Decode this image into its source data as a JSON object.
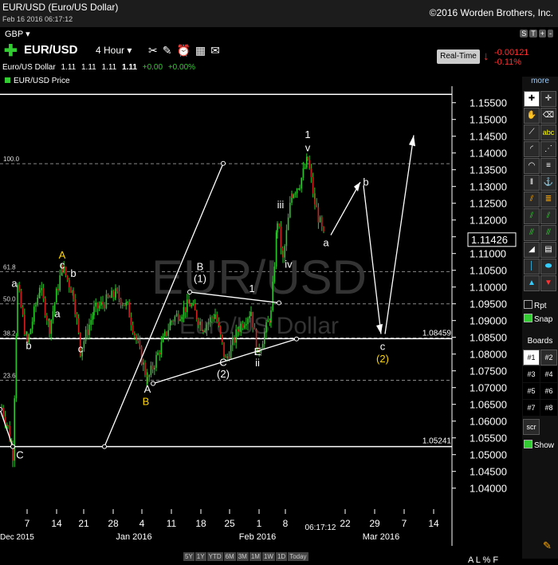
{
  "header": {
    "title": "EUR/USD (Euro/US Dollar)",
    "datetime": "Feb 16 2016 06:17:12",
    "copyright": "©2016 Worden Brothers, Inc."
  },
  "toolbar": {
    "currency": "GBP",
    "symbol": "EUR/USD",
    "interval": "4 Hour",
    "realtime_label": "Real-Time",
    "change": "-0.00121",
    "change_pct": "-0.11%",
    "right_buttons": [
      "S",
      "T",
      "+",
      "-"
    ]
  },
  "quote": {
    "name": "Euro/US Dollar",
    "open": "1.11",
    "high": "1.11",
    "low": "1.11",
    "last": "1.11",
    "change": "+0.00",
    "change_pct": "+0.00%"
  },
  "legend": {
    "label": "EUR/USD Price"
  },
  "watermark": {
    "symbol": "EUR/USD",
    "name": "Euro/US Dollar"
  },
  "chart_data": {
    "type": "candlestick",
    "title": "EUR/USD (Euro/US Dollar)",
    "series": [
      {
        "name": "EUR/USD Price",
        "color": "#33cc33"
      }
    ],
    "ylim": [
      1.0375,
      1.1585
    ],
    "yticks": [
      "1.15500",
      "1.15000",
      "1.14500",
      "1.14000",
      "1.13500",
      "1.13000",
      "1.12500",
      "1.12000",
      "1.11500",
      "1.11000",
      "1.10500",
      "1.10000",
      "1.09500",
      "1.09000",
      "1.08500",
      "1.08000",
      "1.07500",
      "1.07000",
      "1.06500",
      "1.06000",
      "1.05500",
      "1.05000",
      "1.04500",
      "1.04000"
    ],
    "xticks": [
      "7",
      "14",
      "21",
      "28",
      "4",
      "11",
      "18",
      "25",
      "1",
      "8",
      "22",
      "29",
      "7",
      "14"
    ],
    "month_labels": [
      "Dec 2015",
      "Jan 2016",
      "Feb 2016",
      "Mar 2016"
    ],
    "time_label": "06:17:12",
    "last_price": "1.11426",
    "horizontal_levels": [
      {
        "value": 1.1575,
        "label": ""
      },
      {
        "value": 1.08459,
        "label": "1.08459"
      },
      {
        "value": 1.05241,
        "label": "1.05241"
      }
    ],
    "fib_levels": [
      {
        "label": "100.0",
        "value": 1.1368
      },
      {
        "label": "61.8",
        "value": 1.1046
      },
      {
        "label": "50.0",
        "value": 1.095
      },
      {
        "label": "38.2",
        "value": 1.0848
      },
      {
        "label": "23.6",
        "value": 1.0722
      }
    ],
    "wave_labels": [
      {
        "text": "a",
        "x": 18,
        "y": 1.1,
        "color": "#ffffff"
      },
      {
        "text": "b",
        "x": 36,
        "y": 1.0815,
        "color": "#ffffff"
      },
      {
        "text": "A",
        "x": 78,
        "y": 1.1085,
        "color": "#ffd700"
      },
      {
        "text": "c",
        "x": 78,
        "y": 1.1055,
        "color": "#ffffff"
      },
      {
        "text": "b",
        "x": 92,
        "y": 1.103,
        "color": "#ffffff"
      },
      {
        "text": "a",
        "x": 72,
        "y": 1.091,
        "color": "#ffffff"
      },
      {
        "text": "c",
        "x": 101,
        "y": 1.0805,
        "color": "#ffffff"
      },
      {
        "text": "C",
        "x": 25,
        "y": 1.0488,
        "color": "#ffffff"
      },
      {
        "text": "B",
        "x": 251,
        "y": 1.105,
        "color": "#ffffff"
      },
      {
        "text": "(1)",
        "x": 251,
        "y": 1.1015,
        "color": "#ffffff"
      },
      {
        "text": "1",
        "x": 316,
        "y": 1.0985,
        "color": "#ffffff"
      },
      {
        "text": "A",
        "x": 185,
        "y": 1.0685,
        "color": "#ffffff"
      },
      {
        "text": "B",
        "x": 183,
        "y": 1.0648,
        "color": "#ffd700"
      },
      {
        "text": "C",
        "x": 280,
        "y": 1.0765,
        "color": "#ffffff"
      },
      {
        "text": "(2)",
        "x": 280,
        "y": 1.073,
        "color": "#ffffff"
      },
      {
        "text": "E",
        "x": 323,
        "y": 1.0797,
        "color": "#ffffff"
      },
      {
        "text": "ii",
        "x": 323,
        "y": 1.0763,
        "color": "#ffffff"
      },
      {
        "text": "iii",
        "x": 352,
        "y": 1.1235,
        "color": "#ffffff"
      },
      {
        "text": "iv",
        "x": 362,
        "y": 1.1058,
        "color": "#ffffff"
      },
      {
        "text": "1",
        "x": 386,
        "y": 1.1445,
        "color": "#ffffff"
      },
      {
        "text": "v",
        "x": 386,
        "y": 1.1405,
        "color": "#ffffff"
      },
      {
        "text": "b",
        "x": 459,
        "y": 1.1303,
        "color": "#ffffff"
      },
      {
        "text": "a",
        "x": 409,
        "y": 1.1122,
        "color": "#ffffff"
      },
      {
        "text": "c",
        "x": 480,
        "y": 1.0812,
        "color": "#ffffff"
      },
      {
        "text": "(2)",
        "x": 480,
        "y": 1.0775,
        "color": "#ffd700"
      }
    ]
  },
  "sidebar": {
    "more_label": "more",
    "rpt_label": "Rpt",
    "snap_label": "Snap",
    "boards_label": "Boards",
    "boards": [
      "#1",
      "#2",
      "#3",
      "#4",
      "#5",
      "#6",
      "#7",
      "#8"
    ],
    "scr_label": "scr",
    "show_label": "Show"
  },
  "bottom": {
    "periods": [
      "5Y",
      "1Y",
      "YTD",
      "6M",
      "3M",
      "1M",
      "1W",
      "1D",
      "Today"
    ],
    "alpf": "A L % F"
  }
}
